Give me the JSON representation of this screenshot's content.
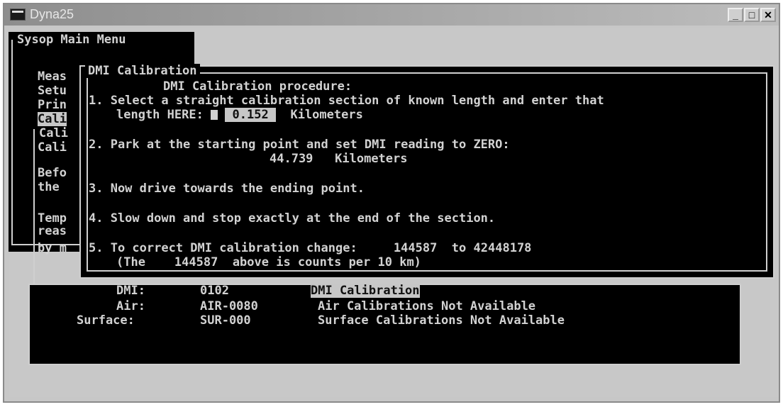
{
  "window": {
    "title": "Dyna25"
  },
  "controls": {
    "minimize": "_",
    "maximize": "□",
    "close": "✕"
  },
  "main_menu": {
    "title": "Sysop Main Menu",
    "items": [
      "Meas",
      "Setu",
      "Prin",
      "Cali"
    ],
    "sub_title": "Cali",
    "sub_lines": [
      "Cali",
      "Befo",
      "the",
      "Temp",
      "reas",
      "by m"
    ]
  },
  "dmi_dialog": {
    "title": "DMI Calibration",
    "heading": "DMI Calibration procedure:",
    "step1_line1": "1. Select a straight calibration section of known length and enter that",
    "step1_prefix": "length HERE: ",
    "step1_value": " 0.152 ",
    "step1_unit": "Kilometers",
    "step2_line1": "2. Park at the starting point and set DMI reading to ZERO:",
    "step2_value": "44.739",
    "step2_unit": "Kilometers",
    "step3": "3. Now drive towards the ending point.",
    "step4": "4. Slow down and stop exactly at the end of the section.",
    "step5_prefix": "5. To correct DMI calibration change:",
    "step5_from": "144587",
    "step5_to_label": "to",
    "step5_to": "42448178",
    "step5_note_open": "(The",
    "step5_note_value": "144587",
    "step5_note_rest": "above is counts per 10 km)"
  },
  "calibrations": [
    {
      "label": "DMI:",
      "code": "0102",
      "status": "DMI Calibration"
    },
    {
      "label": "Air:",
      "code": "AIR-0080",
      "status": "Air Calibrations Not Available"
    },
    {
      "label": "Surface:",
      "code": "SUR-000",
      "status": "Surface Calibrations Not Available"
    }
  ]
}
